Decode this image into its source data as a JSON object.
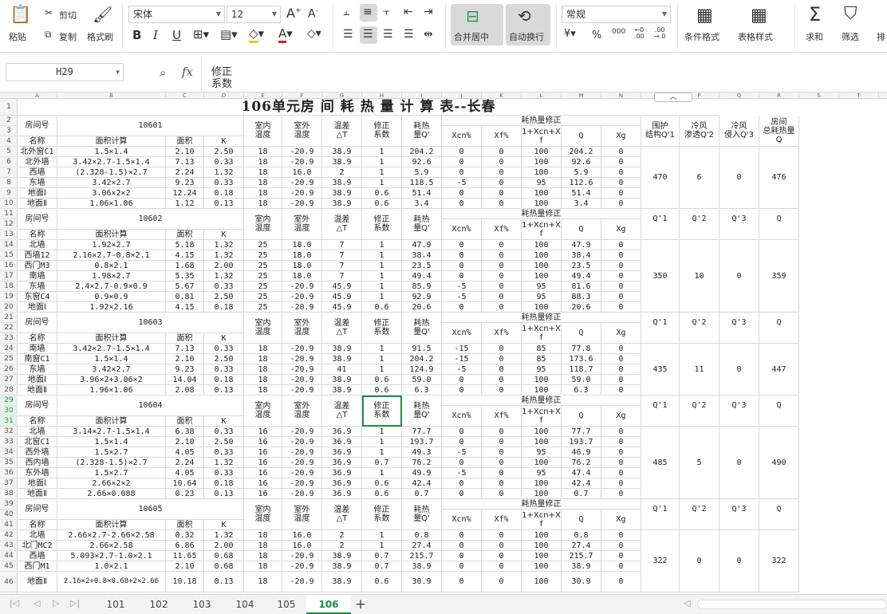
{
  "ribbon": {
    "paste": "粘贴",
    "cut": "剪切",
    "copy": "复制",
    "format_painter": "格式刷",
    "font": "宋体",
    "font_size": "12",
    "merge_center": "合并居中",
    "wrap_text": "自动换行",
    "number_format": "常规",
    "percent": "%",
    "thousands": "000",
    "conditional_format": "条件格式",
    "table_style": "表格样式",
    "sum": "求和",
    "filter": "筛选",
    "sort": "排"
  },
  "formula_bar": {
    "cell_ref": "H29",
    "fx": "fx",
    "content_line1": "修正",
    "content_line2": "系数"
  },
  "columns": [
    "A",
    "B",
    "C",
    "D",
    "E",
    "F",
    "G",
    "H",
    "I",
    "J",
    "K",
    "L",
    "M",
    "N",
    "O",
    "P",
    "Q",
    "R",
    "S",
    "T"
  ],
  "rows": [
    "1",
    "2",
    "3",
    "4",
    "5",
    "6",
    "7",
    "8",
    "9",
    "10",
    "11",
    "12",
    "13",
    "14",
    "15",
    "16",
    "17",
    "18",
    "19",
    "20",
    "21",
    "22",
    "23",
    "24",
    "25",
    "26",
    "27",
    "28",
    "29",
    "30",
    "31",
    "32",
    "33",
    "34",
    "35",
    "36",
    "37",
    "38",
    "39",
    "40",
    "41",
    "42",
    "43",
    "44",
    "45",
    "46"
  ],
  "title": "106单元房 间 耗 热 量 计 算 表--长春",
  "headers": {
    "room_no": "房间号",
    "name": "名称",
    "area_calc": "面积计算",
    "area": "面积",
    "k": "K",
    "indoor": "室内温度",
    "outdoor": "室外温度",
    "temp_diff": "温差△T",
    "correction": "修正系数",
    "heat": "耗热量Q'",
    "heat_correction": "耗热量修正",
    "xcn": "Xcn%",
    "xf": "Xf%",
    "factor": "1+Xcn+Xf",
    "q": "Q",
    "xg": "Xg",
    "envelope": "围护结构Q'1",
    "cold_air_pen": "冷风渗透Q'2",
    "cold_air_in": "冷风侵入Q'3",
    "room_total": "房间总耗热量Q",
    "q1": "Q'1",
    "q2": "Q'2",
    "q3": "Q'3"
  },
  "blocks": [
    {
      "room": "10601",
      "rows": [
        [
          "北外窗C1",
          "1.5×1.4",
          "2.10",
          "2.50",
          "18",
          "-20.9",
          "38.9",
          "1",
          "204.2",
          "0",
          "0",
          "100",
          "204.2",
          "0"
        ],
        [
          "北外墙",
          "3.42×2.7-1.5×1.4",
          "7.13",
          "0.33",
          "18",
          "-20.9",
          "38.9",
          "1",
          "92.6",
          "0",
          "0",
          "100",
          "92.6",
          "0"
        ],
        [
          "西墙",
          "(2.328-1.5)×2.7",
          "2.24",
          "1.32",
          "18",
          "16.0",
          "2",
          "1",
          "5.9",
          "0",
          "0",
          "100",
          "5.9",
          "0"
        ],
        [
          "东墙",
          "3.42×2.7",
          "9.23",
          "0.33",
          "18",
          "-20.9",
          "38.9",
          "1",
          "118.5",
          "-5",
          "0",
          "95",
          "112.6",
          "0"
        ],
        [
          "地面Ⅰ",
          "3.06×2×2",
          "12.24",
          "0.18",
          "18",
          "-20.9",
          "38.9",
          "0.6",
          "51.4",
          "0",
          "0",
          "100",
          "51.4",
          "0"
        ],
        [
          "地面Ⅱ",
          "1.06×1.06",
          "1.12",
          "0.13",
          "18",
          "-20.9",
          "38.9",
          "0.6",
          "3.4",
          "0",
          "0",
          "100",
          "3.4",
          "0"
        ]
      ],
      "summary": [
        "470",
        "6",
        "0",
        "476"
      ]
    },
    {
      "room": "10602",
      "rows": [
        [
          "北墙",
          "1.92×2.7",
          "5.18",
          "1.32",
          "25",
          "18.0",
          "7",
          "1",
          "47.9",
          "0",
          "0",
          "100",
          "47.9",
          "0"
        ],
        [
          "西墙12",
          "2.16×2.7-0.8×2.1",
          "4.15",
          "1.32",
          "25",
          "18.0",
          "7",
          "1",
          "38.4",
          "0",
          "0",
          "100",
          "38.4",
          "0"
        ],
        [
          "西门M3",
          "0.8×2.1",
          "1.68",
          "2.00",
          "25",
          "18.0",
          "7",
          "1",
          "23.5",
          "0",
          "0",
          "100",
          "23.5",
          "0"
        ],
        [
          "南墙",
          "1.98×2.7",
          "5.35",
          "1.32",
          "25",
          "18.0",
          "7",
          "1",
          "49.4",
          "0",
          "0",
          "100",
          "49.4",
          "0"
        ],
        [
          "东墙",
          "2.4×2.7-0.9×0.9",
          "5.67",
          "0.33",
          "25",
          "-20.9",
          "45.9",
          "1",
          "85.9",
          "-5",
          "0",
          "95",
          "81.6",
          "0"
        ],
        [
          "东窗C4",
          "0.9×0.9",
          "0.81",
          "2.50",
          "25",
          "-20.9",
          "45.9",
          "1",
          "92.9",
          "-5",
          "0",
          "95",
          "88.3",
          "0"
        ],
        [
          "地面Ⅰ",
          "1.92×2.16",
          "4.15",
          "0.18",
          "25",
          "-20.9",
          "45.9",
          "0.6",
          "20.6",
          "0",
          "0",
          "100",
          "20.6",
          "0"
        ]
      ],
      "summary": [
        "350",
        "10",
        "0",
        "359"
      ]
    },
    {
      "room": "10603",
      "rows": [
        [
          "南墙",
          "3.42×2.7-1.5×1.4",
          "7.13",
          "0.33",
          "18",
          "-20.9",
          "38.9",
          "1",
          "91.5",
          "-15",
          "0",
          "85",
          "77.8",
          "0"
        ],
        [
          "南窗C1",
          "1.5×1.4",
          "2.10",
          "2.50",
          "18",
          "-20.9",
          "38.9",
          "1",
          "204.2",
          "-15",
          "0",
          "85",
          "173.6",
          "0"
        ],
        [
          "东墙",
          "3.42×2.7",
          "9.23",
          "0.33",
          "18",
          "-20.9",
          "41",
          "1",
          "124.9",
          "-5",
          "0",
          "95",
          "118.7",
          "0"
        ],
        [
          "地面Ⅰ",
          "3.96×2+3.06×2",
          "14.04",
          "0.18",
          "18",
          "-20.9",
          "38.9",
          "0.6",
          "59.0",
          "0",
          "0",
          "100",
          "59.0",
          "0"
        ],
        [
          "地面Ⅱ",
          "1.96×1.06",
          "2.08",
          "0.13",
          "18",
          "-20.9",
          "38.9",
          "0.6",
          "6.3",
          "0",
          "0",
          "100",
          "6.3",
          "0"
        ]
      ],
      "summary": [
        "435",
        "11",
        "0",
        "447"
      ]
    },
    {
      "room": "10604",
      "rows": [
        [
          "北墙",
          "3.14×2.7-1.5×1.4",
          "6.38",
          "0.33",
          "16",
          "-20.9",
          "36.9",
          "1",
          "77.7",
          "0",
          "0",
          "100",
          "77.7",
          "0"
        ],
        [
          "北窗C1",
          "1.5×1.4",
          "2.10",
          "2.50",
          "16",
          "-20.9",
          "36.9",
          "1",
          "193.7",
          "0",
          "0",
          "100",
          "193.7",
          "0"
        ],
        [
          "西外墙",
          "1.5×2.7",
          "4.05",
          "0.33",
          "16",
          "-20.9",
          "36.9",
          "1",
          "49.3",
          "-5",
          "0",
          "95",
          "46.9",
          "0"
        ],
        [
          "西内墙",
          "(2.328-1.5)×2.7",
          "2.24",
          "1.32",
          "16",
          "-20.9",
          "36.9",
          "0.7",
          "76.2",
          "0",
          "0",
          "100",
          "76.2",
          "0"
        ],
        [
          "东外墙",
          "1.5×2.7",
          "4.05",
          "0.33",
          "16",
          "-20.9",
          "36.9",
          "1",
          "49.9",
          "-5",
          "0",
          "95",
          "47.4",
          "0"
        ],
        [
          "地面Ⅰ",
          "2.66×2×2",
          "10.64",
          "0.18",
          "16",
          "-20.9",
          "36.9",
          "0.6",
          "42.4",
          "0",
          "0",
          "100",
          "42.4",
          "0"
        ],
        [
          "地面Ⅱ",
          "2.66×0.088",
          "0.23",
          "0.13",
          "16",
          "-20.9",
          "36.9",
          "0.6",
          "0.7",
          "0",
          "0",
          "100",
          "0.7",
          "0"
        ]
      ],
      "summary": [
        "485",
        "5",
        "0",
        "490"
      ]
    },
    {
      "room": "10605",
      "rows": [
        [
          "北墙",
          "2.66×2.7-2.66×2.58",
          "0.32",
          "1.32",
          "18",
          "16.0",
          "2",
          "1",
          "0.8",
          "0",
          "0",
          "100",
          "0.8",
          "0"
        ],
        [
          "北门MC2",
          "2.66×2.58",
          "6.86",
          "2.00",
          "18",
          "16.0",
          "2",
          "1",
          "27.4",
          "0",
          "0",
          "100",
          "27.4",
          "0"
        ],
        [
          "西墙",
          "5.093×2.7-1.0×2.1",
          "11.65",
          "0.68",
          "18",
          "-20.9",
          "38.9",
          "0.7",
          "215.7",
          "0",
          "0",
          "100",
          "215.7",
          "0"
        ],
        [
          "西门M1",
          "1.0×2.1",
          "2.10",
          "0.68",
          "18",
          "-20.9",
          "38.9",
          "0.7",
          "38.9",
          "0",
          "0",
          "100",
          "38.9",
          "0"
        ],
        [
          "地面Ⅱ",
          "2.16×2+0.8×0.68+2×2.66",
          "10.18",
          "0.13",
          "18",
          "-20.9",
          "38.9",
          "0.6",
          "30.9",
          "0",
          "0",
          "100",
          "30.9",
          "0"
        ]
      ],
      "summary": [
        "322",
        "0",
        "0",
        "322"
      ]
    }
  ],
  "sheets": [
    "101",
    "102",
    "103",
    "104",
    "105",
    "106"
  ],
  "active_sheet": "106",
  "add_sheet": "+"
}
